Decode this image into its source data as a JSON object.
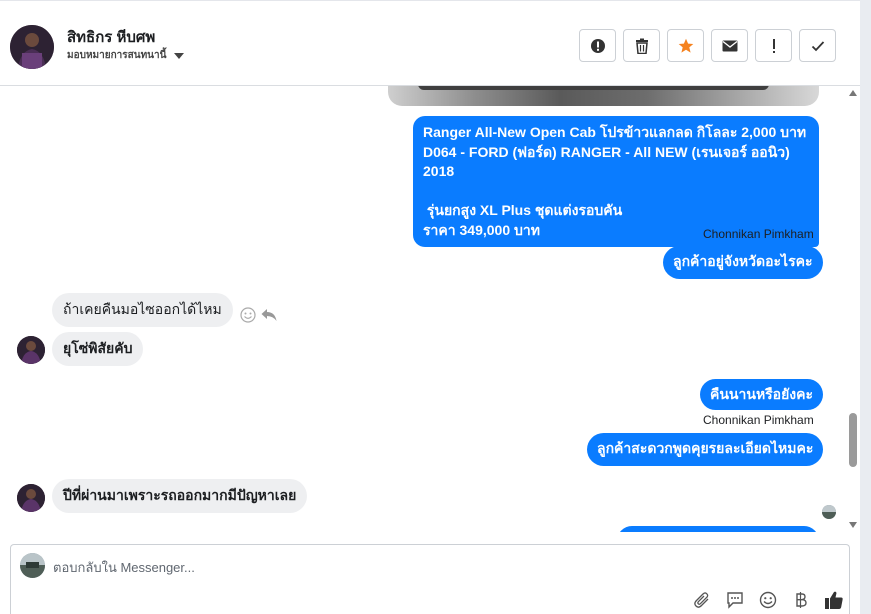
{
  "header": {
    "contact_name": "สิทธิกร หีบศพ",
    "assign_label": "มอบหมายการสนทนานี้",
    "actions": [
      {
        "name": "mark-spam-button",
        "icon": "alert-circle-icon"
      },
      {
        "name": "delete-button",
        "icon": "trash-icon"
      },
      {
        "name": "star-button",
        "icon": "star-icon"
      },
      {
        "name": "mark-unread-button",
        "icon": "envelope-icon"
      },
      {
        "name": "follow-up-button",
        "icon": "exclamation-icon"
      },
      {
        "name": "mark-done-button",
        "icon": "checkmark-icon"
      }
    ]
  },
  "messages": {
    "m1": {
      "lines": [
        "Ranger All-New Open Cab โปรข้าวแลกลด กิโลละ 2,000 บาท",
        "D064 - FORD (ฟอร์ด) RANGER - All NEW (เรนเจอร์ ออนิว) 2018",
        " ",
        " รุ่นยกสูง XL Plus ชุดแต่งรอบคัน",
        "ราคา 349,000 บาท"
      ]
    },
    "sender_a": "Chonnikan Pimkham",
    "m2": "ลูกค้าอยู่จังหวัดอะไรคะ",
    "m3": "ถ้าเคยคืนมอไซออกได้ไหม",
    "m4": "ยุโซ่พิสัยคับ",
    "m5": "คืนนานหรือยังคะ",
    "sender_b": "Chonnikan Pimkham",
    "m6": "ลูกค้าสะดวกพูดคุยรยละเอียดไหมคะ",
    "m7": "ปีที่ผ่านมาเพราะรถออกมากมีปัญหาเลย"
  },
  "composer": {
    "placeholder": "ตอบกลับใน Messenger...",
    "tools": [
      "attach-icon",
      "saved-reply-icon",
      "emoji-icon",
      "baht-payment-icon",
      "like-icon"
    ]
  },
  "colors": {
    "outgoing_bubble": "#0a7cff",
    "incoming_bubble": "#eeeff1",
    "star": "#f5821f"
  }
}
